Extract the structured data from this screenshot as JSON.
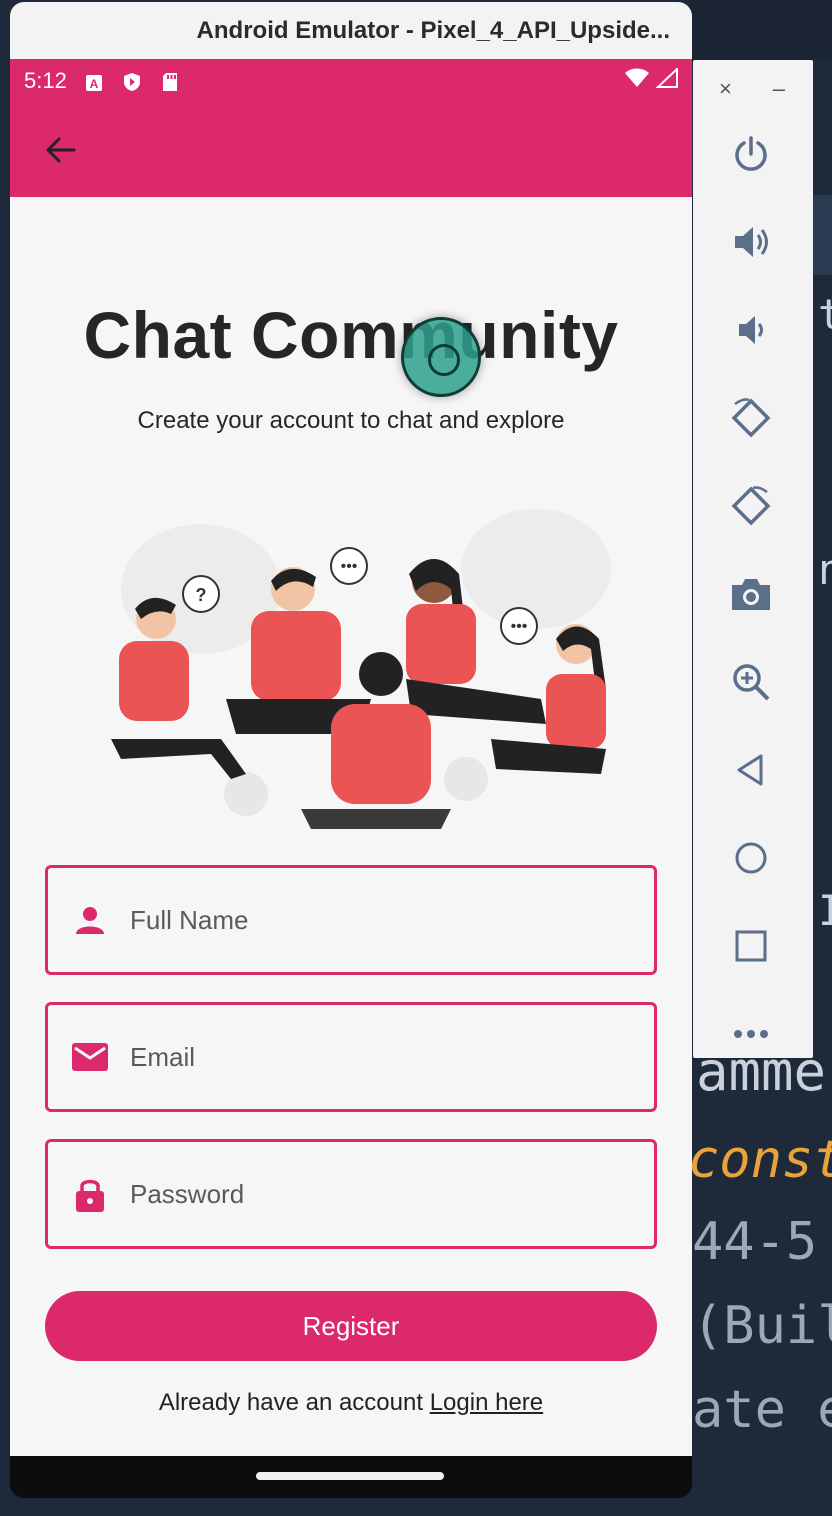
{
  "window": {
    "title": "Android Emulator - Pixel_4_API_Upside..."
  },
  "status_bar": {
    "time": "5:12",
    "icons": [
      "a-icon",
      "shield-icon",
      "sd-card-icon",
      "wifi-icon",
      "signal-icon"
    ]
  },
  "app_bar": {
    "back_icon": "arrow-back-icon"
  },
  "main": {
    "title": "Chat Community",
    "subtitle": "Create your account to chat and explore",
    "illustration": "group-of-people-chatting"
  },
  "form": {
    "full_name_placeholder": "Full Name",
    "email_placeholder": "Email",
    "password_placeholder": "Password",
    "register_label": "Register",
    "login_prompt": "Already have an account",
    "login_link": "Login here"
  },
  "side_panel": {
    "close": "×",
    "minimize": "–",
    "buttons": [
      "power-icon",
      "volume-up-icon",
      "volume-down-icon",
      "rotate-left-icon",
      "rotate-right-icon",
      "camera-icon",
      "zoom-icon",
      "back-icon",
      "home-icon",
      "overview-icon",
      "more-icon"
    ]
  },
  "background_code": [
    "e",
    "const",
    "44-5",
    "(Buil",
    "ate e",
    "t",
    "n",
    "I"
  ],
  "colors": {
    "primary": "#dc296b",
    "background": "#f7f6f6",
    "text": "#262626"
  }
}
